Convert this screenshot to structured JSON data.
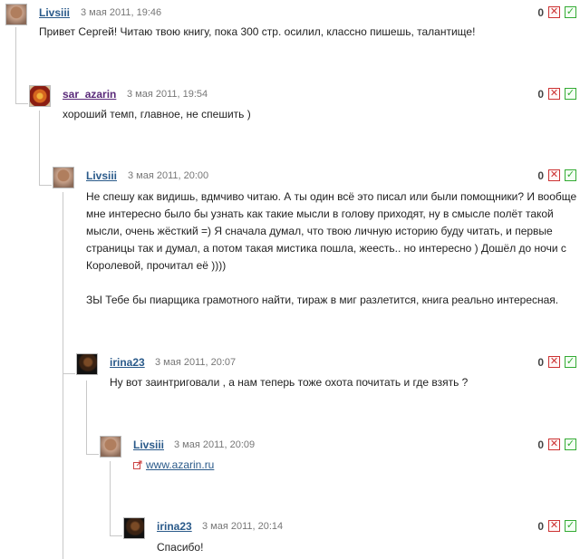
{
  "comments": [
    {
      "author": "Livsiii",
      "date": "3 мая 2011, 19:46",
      "score": "0",
      "text": [
        "Привет Сергей! Читаю твою книгу, пока 300 стр. осилил, классно пишешь, талантище!"
      ]
    },
    {
      "author": "sar_azarin",
      "date": "3 мая 2011, 19:54",
      "score": "0",
      "text": [
        "хороший темп, главное, не спешить )"
      ]
    },
    {
      "author": "Livsiii",
      "date": "3 мая 2011, 20:00",
      "score": "0",
      "text": [
        "Не спешу как видишь, вдмчиво читаю. А ты один всё это писал или были помощники? И вообще",
        "мне интересно было бы узнать как такие мысли в голову приходят, ну в смысле полёт такой",
        "мысли, очень жёсткий =) Я сначала думал, что твою личную историю буду читать, и первые",
        "страницы так и думал, а потом такая мистика пошла, жеесть.. но интересно ) Дошёл до ночи с",
        "Королевой, прочитал её ))))",
        "",
        "ЗЫ Тебе бы пиарщика грамотного найти, тираж в миг разлетится, книга реально интересная."
      ]
    },
    {
      "author": "irina23",
      "date": "3 мая 2011, 20:07",
      "score": "0",
      "text": [
        "Ну вот заинтриговали , а нам теперь тоже охота почитать и где взять ?"
      ]
    },
    {
      "author": "Livsiii",
      "date": "3 мая 2011, 20:09",
      "score": "0",
      "link": "www.azarin.ru"
    },
    {
      "author": "irina23",
      "date": "3 мая 2011, 20:14",
      "score": "0",
      "text": [
        "Спасибо!"
      ]
    }
  ],
  "icons": {
    "vote_down": "✕",
    "vote_up": "✓"
  },
  "colors": {
    "author_link": "#2a5a8a",
    "author_highlight": "#5a2a7a",
    "vote_down": "#cc3333",
    "vote_up": "#33aa33"
  }
}
